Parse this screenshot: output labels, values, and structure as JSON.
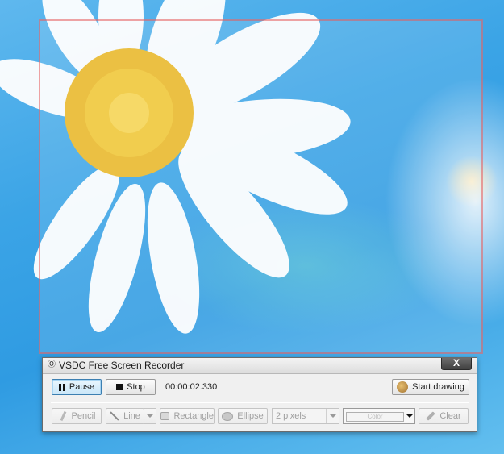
{
  "window": {
    "title": "VSDC Free Screen Recorder",
    "close_label": "X"
  },
  "recording": {
    "pause_label": "Pause",
    "stop_label": "Stop",
    "elapsed_time": "00:00:02.330",
    "start_drawing_label": "Start drawing"
  },
  "drawing_tools": {
    "pencil_label": "Pencil",
    "line_label": "Line",
    "rectangle_label": "Rectangle",
    "ellipse_label": "Ellipse",
    "thickness_value": "2 pixels",
    "color_label": "Color",
    "clear_label": "Clear"
  },
  "colors": {
    "capture_frame": "#e65a5a",
    "desktop_blue": "#3ba4e6"
  },
  "icons": {
    "app": "app-icon",
    "pause": "pause-icon",
    "stop": "stop-icon",
    "start_drawing": "draw-palette-icon",
    "pencil": "pencil-icon",
    "line": "line-icon",
    "rectangle": "rectangle-icon",
    "ellipse": "ellipse-icon",
    "clear": "eraser-icon"
  }
}
